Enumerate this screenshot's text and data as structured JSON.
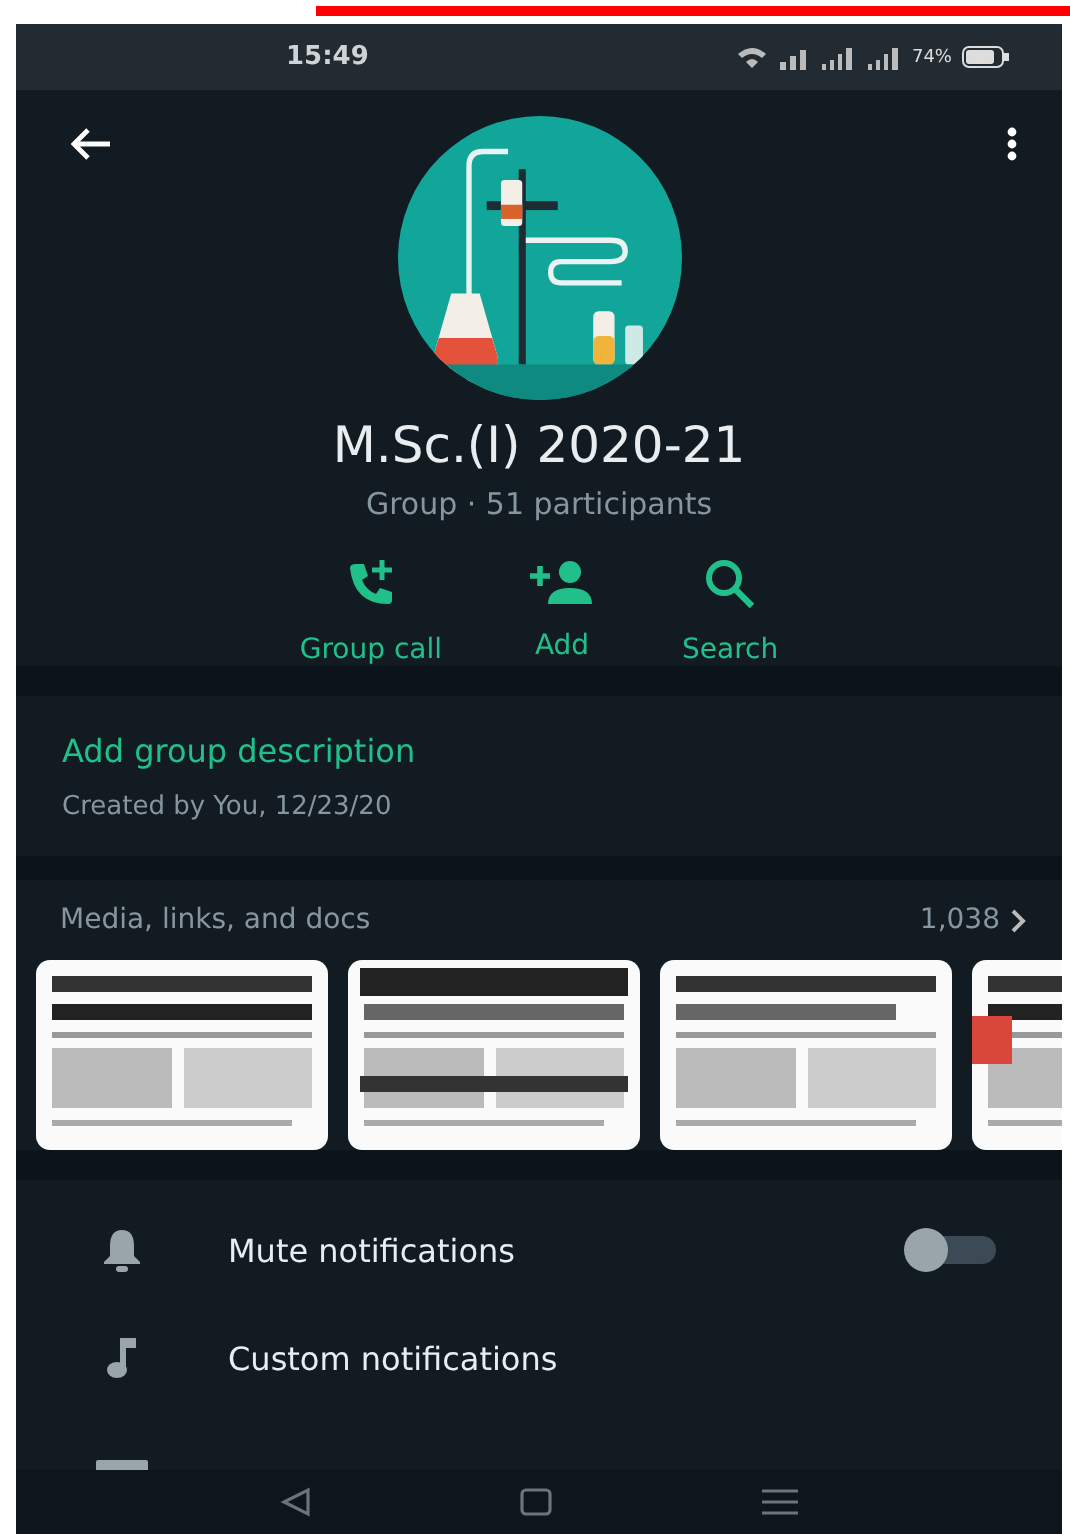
{
  "status_bar": {
    "time": "15:49",
    "battery": "74%"
  },
  "group": {
    "name": "M.Sc.(I) 2020-21",
    "subtitle": "Group · 51 participants"
  },
  "actions": [
    {
      "kind": "call",
      "label": "Group call"
    },
    {
      "kind": "add",
      "label": "Add"
    },
    {
      "kind": "search",
      "label": "Search"
    }
  ],
  "description": {
    "link": "Add group description",
    "created": "Created by You, 12/23/20"
  },
  "media": {
    "title": "Media, links, and docs",
    "count": "1,038"
  },
  "settings": [
    {
      "kind": "toggle",
      "label": "Mute notifications",
      "on": false
    },
    {
      "kind": "plain",
      "label": "Custom notifications"
    }
  ]
}
